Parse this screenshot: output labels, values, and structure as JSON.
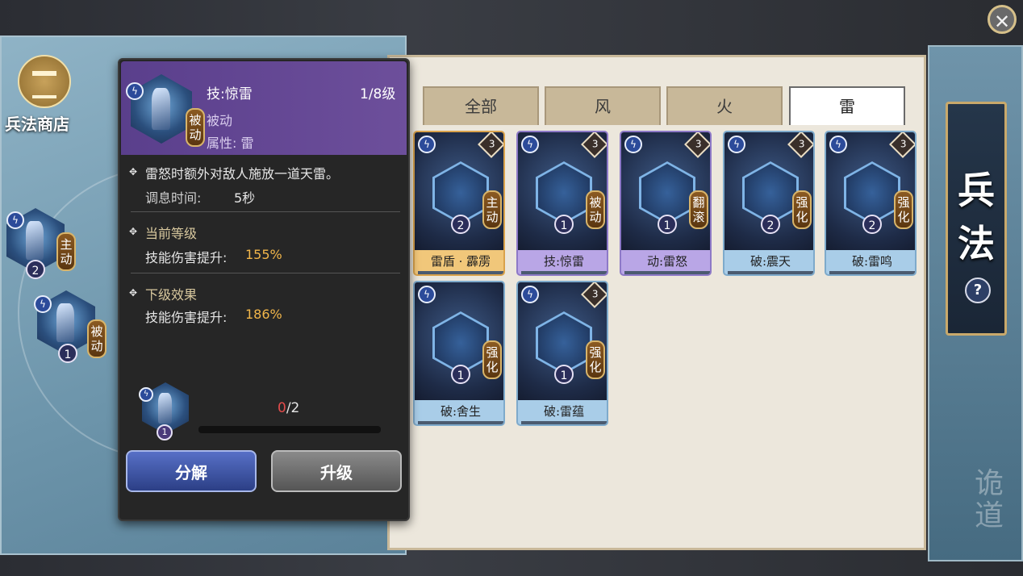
{
  "shop": {
    "label": "兵法商店"
  },
  "side_title": {
    "chars": [
      "兵",
      "法"
    ],
    "watermark": "诡道"
  },
  "close_icon": "close-icon",
  "tooltip": {
    "skill_name": "技:惊雷",
    "level": "1/8级",
    "type": "被动",
    "attribute": "属性: 雷",
    "tag": [
      "被",
      "动"
    ],
    "description": "雷怒时额外对敌人施放一道天雷。",
    "cooldown_label": "调息时间:",
    "cooldown_value": "5秒",
    "current_level_title": "当前等级",
    "current_effect_label": "技能伤害提升:",
    "current_effect_value": "155%",
    "next_level_title": "下级效果",
    "next_effect_label": "技能伤害提升:",
    "next_effect_value": "186%",
    "owned_badge": "1",
    "progress_current": "0",
    "progress_total": "/2",
    "progress_fraction": 0,
    "decompose_label": "分解",
    "upgrade_label": "升级"
  },
  "tabs": [
    "全部",
    "风",
    "火",
    "雷"
  ],
  "active_tab": 3,
  "cards": [
    {
      "name": "雷盾 · 霹雳",
      "tag": [
        "主",
        "动"
      ],
      "level": "2",
      "rarity": "3",
      "style": "gold"
    },
    {
      "name": "技:惊雷",
      "tag": [
        "被",
        "动"
      ],
      "level": "1",
      "rarity": "3",
      "style": "purple"
    },
    {
      "name": "动:雷怒",
      "tag": [
        "翻",
        "滚"
      ],
      "level": "1",
      "rarity": "3",
      "style": "purple"
    },
    {
      "name": "破:震天",
      "tag": [
        "强",
        "化"
      ],
      "level": "2",
      "rarity": "3",
      "style": "blue"
    },
    {
      "name": "破:雷鸣",
      "tag": [
        "强",
        "化"
      ],
      "level": "2",
      "rarity": "3",
      "style": "blue"
    },
    {
      "name": "破:舍生",
      "tag": [
        "强",
        "化"
      ],
      "level": "1",
      "rarity": "",
      "style": "blue"
    },
    {
      "name": "破:雷蕴",
      "tag": [
        "强",
        "化"
      ],
      "level": "1",
      "rarity": "3",
      "style": "blue"
    }
  ],
  "left_nodes": [
    {
      "tag": [
        "主",
        "动"
      ],
      "level": "2"
    },
    {
      "tag": [
        "被",
        "动"
      ],
      "level": "1"
    }
  ],
  "help_label": "?"
}
